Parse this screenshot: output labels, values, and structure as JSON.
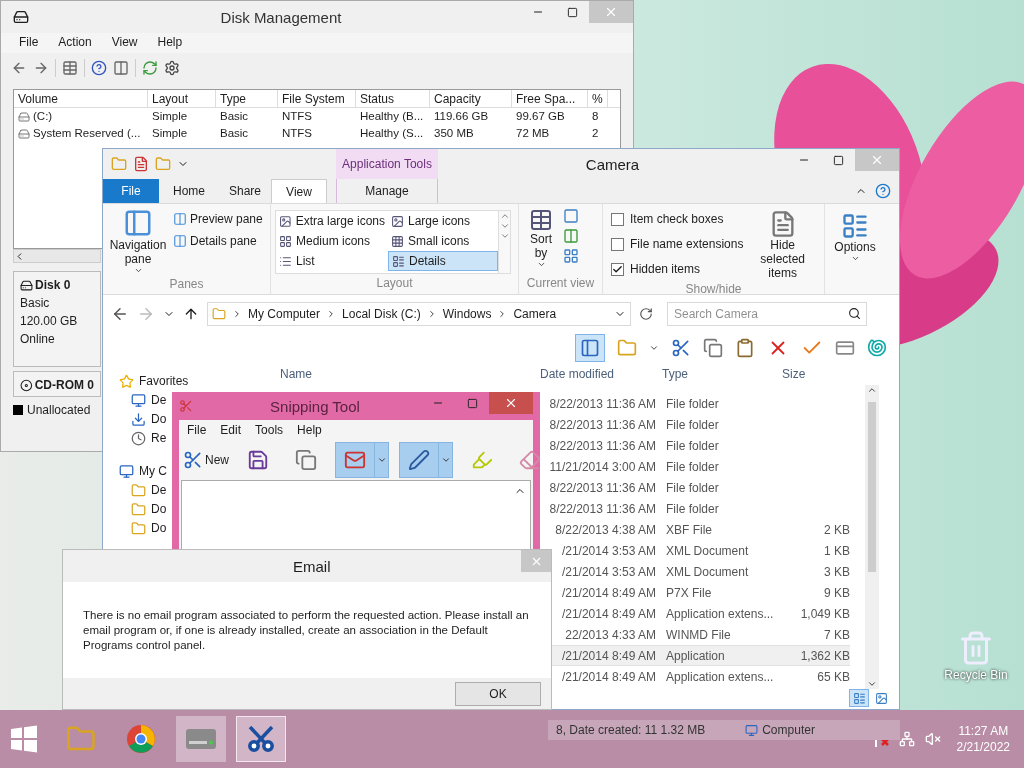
{
  "desktop": {
    "icons": [
      {
        "label": "Recycle Bin"
      }
    ]
  },
  "disk_management": {
    "title": "Disk Management",
    "menu": [
      "File",
      "Action",
      "View",
      "Help"
    ],
    "columns": [
      "Volume",
      "Layout",
      "Type",
      "File System",
      "Status",
      "Capacity",
      "Free Spa...",
      "%"
    ],
    "rows": [
      [
        "(C:)",
        "Simple",
        "Basic",
        "NTFS",
        "Healthy (B...",
        "119.66 GB",
        "99.67 GB",
        "8"
      ],
      [
        "System Reserved (...",
        "Simple",
        "Basic",
        "NTFS",
        "Healthy (S...",
        "350 MB",
        "72 MB",
        "2"
      ]
    ],
    "disks": [
      {
        "name": "Disk 0",
        "kind": "disk",
        "lines": [
          "Basic",
          "120.00 GB",
          "Online"
        ]
      },
      {
        "name": "CD-ROM 0",
        "kind": "cdrom"
      }
    ],
    "legend": [
      {
        "label": "Unallocated",
        "color": "#000000"
      }
    ]
  },
  "explorer": {
    "title": "Camera",
    "contextual_group": "Application Tools",
    "tabs": [
      {
        "label": "File",
        "kind": "file",
        "selected": false
      },
      {
        "label": "Home",
        "kind": "normal",
        "selected": false
      },
      {
        "label": "Share",
        "kind": "normal",
        "selected": false
      },
      {
        "label": "View",
        "kind": "normal",
        "selected": true
      },
      {
        "label": "Manage",
        "kind": "contextual",
        "selected": false
      }
    ],
    "ribbon": {
      "panes": {
        "label": "Panes",
        "navigation": "Navigation pane",
        "items": [
          "Preview pane",
          "Details pane"
        ]
      },
      "layout": {
        "label": "Layout",
        "options": [
          {
            "label": "Extra large icons",
            "selected": false
          },
          {
            "label": "Large icons",
            "selected": false
          },
          {
            "label": "Medium icons",
            "selected": false
          },
          {
            "label": "Small icons",
            "selected": false
          },
          {
            "label": "List",
            "selected": false
          },
          {
            "label": "Details",
            "selected": true
          }
        ]
      },
      "current_view": {
        "label": "Current view",
        "sort": "Sort by"
      },
      "show_hide": {
        "label": "Show/hide",
        "checks": [
          {
            "label": "Item check boxes",
            "checked": false
          },
          {
            "label": "File name extensions",
            "checked": false
          },
          {
            "label": "Hidden items",
            "checked": true
          }
        ],
        "hide_selected": "Hide selected items"
      },
      "options": "Options"
    },
    "breadcrumbs": [
      "My Computer",
      "Local Disk (C:)",
      "Windows",
      "Camera"
    ],
    "search": {
      "placeholder": "Search Camera"
    },
    "nav": [
      {
        "label": "Favorites",
        "kind": "favorites"
      },
      {
        "label": "De",
        "kind": "desktop"
      },
      {
        "label": "Do",
        "kind": "downloads"
      },
      {
        "label": "Re",
        "kind": "recent"
      },
      {
        "label": "My C",
        "kind": "computer"
      },
      {
        "label": "De",
        "kind": "folder"
      },
      {
        "label": "Do",
        "kind": "folder"
      },
      {
        "label": "Do",
        "kind": "folder"
      }
    ],
    "columns": [
      "Name",
      "Date modified",
      "Type",
      "Size"
    ],
    "rows": [
      {
        "date": "8/22/2013 11:36 AM",
        "type": "File folder",
        "selected": false
      },
      {
        "date": "8/22/2013 11:36 AM",
        "type": "File folder",
        "selected": false
      },
      {
        "date": "8/22/2013 11:36 AM",
        "type": "File folder",
        "selected": false
      },
      {
        "date": "11/21/2014 3:00 AM",
        "type": "File folder",
        "selected": false
      },
      {
        "date": "8/22/2013 11:36 AM",
        "type": "File folder",
        "selected": false
      },
      {
        "date": "8/22/2013 11:36 AM",
        "type": "File folder",
        "selected": false
      },
      {
        "date": "8/22/2013 4:38 AM",
        "type": "XBF File",
        "size": "2 KB",
        "selected": false
      },
      {
        "date": "/21/2014 3:53 AM",
        "type": "XML Document",
        "size": "1 KB",
        "selected": false
      },
      {
        "date": "/21/2014 3:53 AM",
        "type": "XML Document",
        "size": "3 KB",
        "selected": false
      },
      {
        "date": "/21/2014 8:49 AM",
        "type": "P7X File",
        "size": "9 KB",
        "selected": false
      },
      {
        "date": "/21/2014 8:49 AM",
        "type": "Application extens...",
        "size": "1,049 KB",
        "selected": false
      },
      {
        "date": "22/2013 4:33 AM",
        "type": "WINMD File",
        "size": "7 KB",
        "selected": false
      },
      {
        "date": "/21/2014 8:49 AM",
        "type": "Application",
        "size": "1,362 KB",
        "selected": true
      },
      {
        "date": "/21/2014 8:49 AM",
        "type": "Application extens...",
        "size": "65 KB",
        "selected": false
      }
    ],
    "view_buttons": [
      {
        "kind": "details",
        "selected": true
      },
      {
        "kind": "large",
        "selected": false
      }
    ],
    "status": [
      "8, Date created: 11 1.32 MB",
      "Computer"
    ]
  },
  "snipping_tool": {
    "title": "Snipping Tool",
    "menu": [
      "File",
      "Edit",
      "Tools",
      "Help"
    ],
    "new_label": "New",
    "tools": [
      {
        "kind": "save",
        "selected": false
      },
      {
        "kind": "copy",
        "selected": false
      },
      {
        "kind": "email",
        "selected": true
      },
      {
        "kind": "pen",
        "selected": true
      },
      {
        "kind": "highlighter",
        "selected": false
      },
      {
        "kind": "eraser",
        "selected": false
      }
    ]
  },
  "email_dialog": {
    "title": "Email",
    "message": "There is no email program associated to perform the requested action. Please install an email program or, if one is already installed, create an association in the Default Programs control panel.",
    "button": "OK"
  },
  "taskbar": {
    "apps": [
      {
        "kind": "explorer",
        "open": false,
        "selected": false
      },
      {
        "kind": "chrome",
        "open": false,
        "selected": false
      },
      {
        "kind": "disk",
        "open": true,
        "selected": false
      },
      {
        "kind": "snipping",
        "open": true,
        "selected": true
      }
    ],
    "time": "11:27 AM",
    "date": "2/21/2022"
  }
}
